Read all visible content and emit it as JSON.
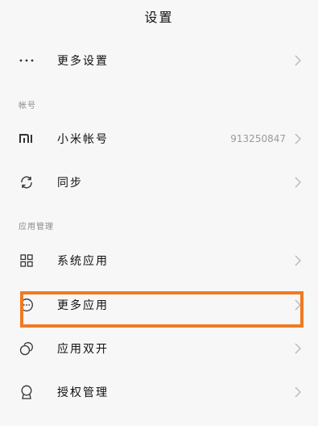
{
  "header": {
    "title": "设置"
  },
  "items_top": [
    {
      "label": "更多设置",
      "icon": "more-dots-icon"
    }
  ],
  "sections": {
    "account": {
      "header": "帐号",
      "items": [
        {
          "label": "小米帐号",
          "value": "913250847",
          "icon": "mi-logo-icon"
        },
        {
          "label": "同步",
          "icon": "sync-icon"
        }
      ]
    },
    "app_management": {
      "header": "应用管理",
      "items": [
        {
          "label": "系统应用",
          "icon": "grid-icon"
        },
        {
          "label": "更多应用",
          "icon": "more-circle-icon"
        },
        {
          "label": "应用双开",
          "icon": "dual-circle-icon"
        },
        {
          "label": "授权管理",
          "icon": "badge-icon"
        }
      ]
    }
  },
  "colors": {
    "background": "#f7f7f7",
    "highlight": "#f07a22",
    "chevron": "#b5b5b5",
    "secondary_text": "#9a9a9a"
  }
}
